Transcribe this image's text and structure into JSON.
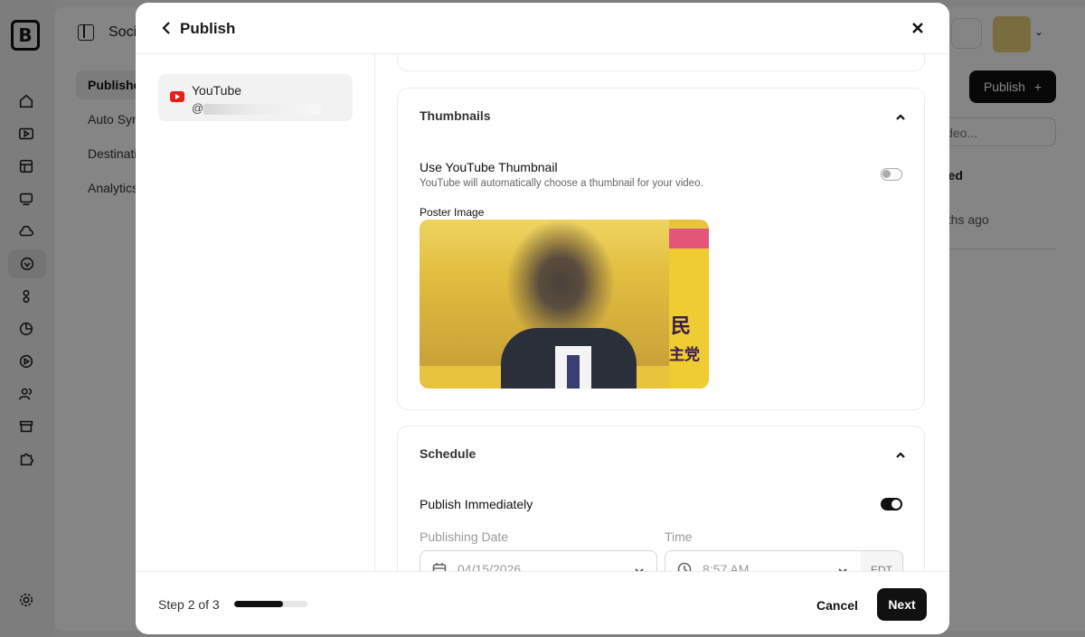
{
  "app": {
    "title": "Soci",
    "subnav": [
      "Publishe",
      "Auto Syn",
      "Destinati",
      "Analytics"
    ],
    "publish_label": "Publish",
    "search_placeholder": "ideo...",
    "column_label": "hed",
    "row_time": "nths ago"
  },
  "modal": {
    "title": "Publish",
    "account": {
      "platform": "YouTube",
      "handle_prefix": "@"
    },
    "thumbnails": {
      "title": "Thumbnails",
      "use_label": "Use YouTube Thumbnail",
      "use_desc": "YouTube will automatically choose a thumbnail for your video.",
      "use_enabled": false,
      "poster_label": "Poster Image",
      "poster_text_top": "民",
      "poster_text_bottom": "主党"
    },
    "schedule": {
      "title": "Schedule",
      "immediate_label": "Publish Immediately",
      "immediate_enabled": true,
      "date_label": "Publishing Date",
      "date_value": "04/15/2026",
      "time_label": "Time",
      "time_value": "8:57 AM",
      "timezone": "EDT"
    },
    "footer": {
      "step_text": "Step 2 of 3",
      "progress": 0.67,
      "cancel_label": "Cancel",
      "next_label": "Next"
    }
  },
  "colors": {
    "accent": "#111111",
    "youtube": "#e62117"
  }
}
